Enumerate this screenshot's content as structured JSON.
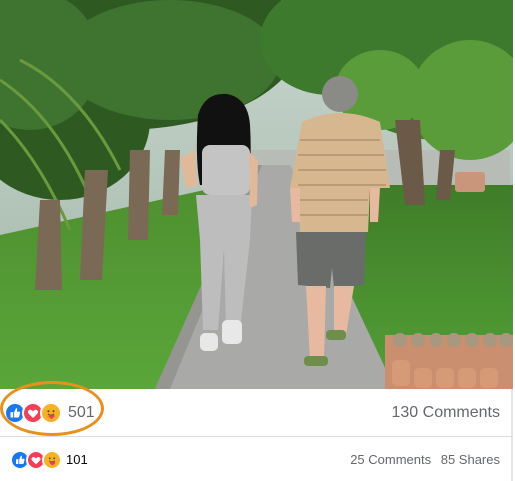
{
  "post": {
    "photo_icon": "photo-people-walking-on-sidewalk",
    "reactions_primary": {
      "icons": [
        "like-icon",
        "love-icon",
        "care-icon"
      ],
      "count": "501",
      "comments": "130 Comments"
    },
    "reactions_secondary": {
      "icons": [
        "like-icon",
        "love-icon",
        "care-icon"
      ],
      "count": "101",
      "comments": "25 Comments",
      "shares": "85 Shares"
    }
  },
  "colors": {
    "like_blue": "#1877f2",
    "love_red": "#f33e58",
    "care_yellow": "#f7b125",
    "highlight_orange": "#e8901d"
  }
}
